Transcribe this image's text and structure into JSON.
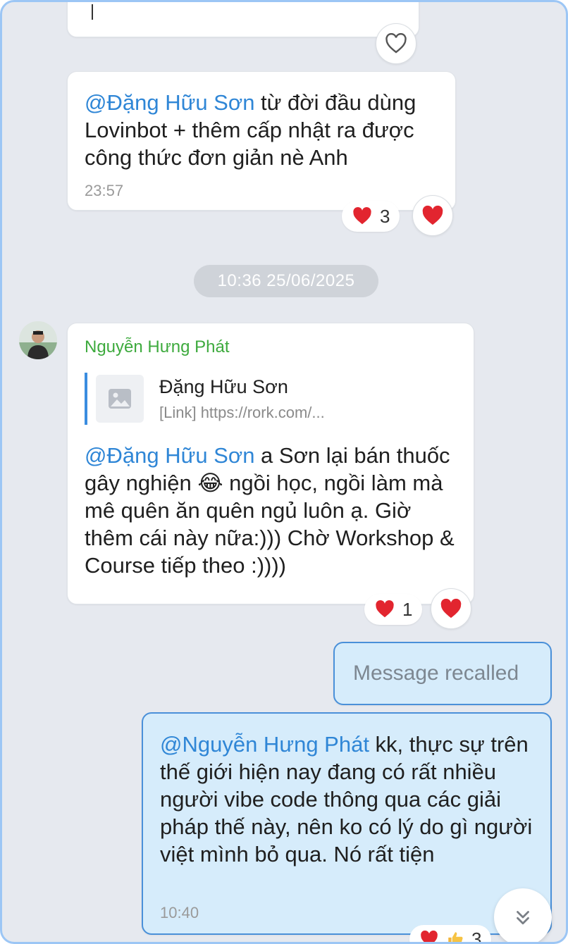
{
  "colors": {
    "frame_border": "#9cc6f5",
    "chat_bg": "#e6e9ef",
    "mention": "#2f86d6",
    "sender_name": "#3daa3d",
    "my_bubble": "#d6ecfb",
    "my_bubble_border": "#4a90d9",
    "heart": "#e2252f"
  },
  "messages": {
    "msg1": {
      "mention": "@Đặng Hữu Sơn",
      "text": " từ đời đầu dùng Lovinbot + thêm cấp nhật ra được công thức đơn giản nè Anh",
      "time": "23:57",
      "reaction_count": "3",
      "reaction_icon": "heart-icon"
    },
    "date_separator": "10:36 25/06/2025",
    "msg2": {
      "sender": "Nguyễn Hưng Phát",
      "quote_title": "Đặng Hữu Sơn",
      "quote_link": "[Link] https://rork.com/...",
      "mention": "@Đặng Hữu Sơn",
      "text_part1": " a Sơn lại bán thuốc gây nghiện ",
      "emoji": "😂",
      "text_part2": "  ngồi học, ngồi làm mà mê quên ăn quên ngủ luôn ạ. Giờ thêm cái này nữa:))) Chờ Workshop & Course tiếp theo :))))",
      "reaction_count": "1",
      "reaction_icon": "heart-icon"
    },
    "recalled": {
      "text": "Message recalled"
    },
    "msg3": {
      "mention": "@Nguyễn Hưng Phát",
      "text": " kk, thực sự trên thế giới hiện nay đang có rất nhiều người vibe code thông qua các giải pháp thế này, nên ko có lý do gì người việt mình bỏ qua. Nó rất tiện",
      "time": "10:40",
      "reaction_count": "3",
      "reaction_icons": [
        "heart-icon",
        "thumbs-up-icon"
      ]
    }
  },
  "controls": {
    "like_icon": "heart-outline-icon",
    "scroll_down_icon": "chevron-double-down-icon"
  }
}
